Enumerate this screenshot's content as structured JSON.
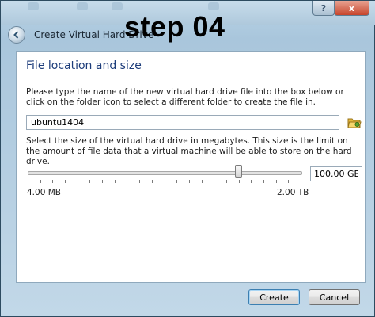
{
  "overlay": {
    "text": "step 04"
  },
  "window": {
    "title": "Create Virtual Hard Drive",
    "help_glyph": "?",
    "close_glyph": "x"
  },
  "panel": {
    "heading": "File location and size",
    "location_text": "Please type the name of the new virtual hard drive file into the box below or click on the folder icon to select a different folder to create the file in.",
    "file_name": "ubuntu1404",
    "size_text": "Select the size of the virtual hard drive in megabytes. This size is the limit on the amount of file data that a virtual machine will be able to store on the hard drive.",
    "size_value": "100.00 GB",
    "slider": {
      "level": 0.77,
      "min_label": "4.00 MB",
      "max_label": "2.00 TB"
    }
  },
  "buttons": {
    "create": "Create",
    "cancel": "Cancel"
  },
  "icons": {
    "back": "back-arrow-icon",
    "folder": "folder-icon",
    "help": "help-icon",
    "close": "close-icon"
  },
  "colors": {
    "heading": "#1c3c7a",
    "accent": "#3c7fb1"
  }
}
